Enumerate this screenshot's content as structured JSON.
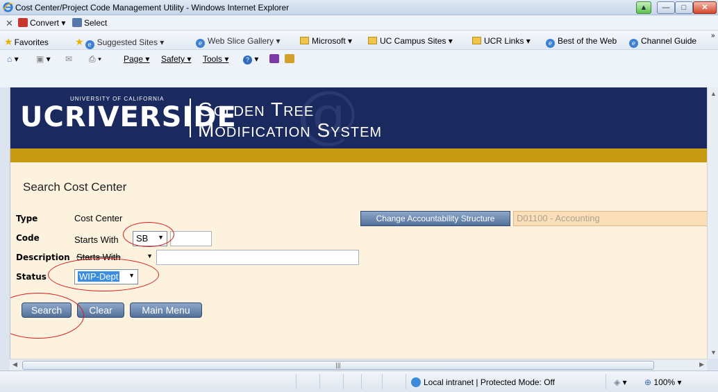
{
  "window": {
    "title": "Cost Center/Project Code Management Utility - Windows Internet Explorer"
  },
  "command_bar_1": {
    "convert_label": "Convert",
    "select_label": "Select"
  },
  "favorites_bar": {
    "favorites_label": "Favorites",
    "items": [
      "Suggested Sites",
      "Web Slice Gallery",
      "Microsoft",
      "UC Campus Sites",
      "UCR Links",
      "Best of the Web",
      "Channel Guide"
    ]
  },
  "command_bar_2": {
    "page_label": "Page",
    "safety_label": "Safety",
    "tools_label": "Tools"
  },
  "banner": {
    "uc_logo": "UCRIVERSIDE",
    "uc_subtitle": "UNIVERSITY OF CALIFORNIA",
    "system_line1": "Golden Tree",
    "system_line2": "Modification System"
  },
  "form": {
    "page_title": "Search Cost Center",
    "type_label": "Type",
    "type_value": "Cost Center",
    "code_label": "Code",
    "code_match": "Starts With",
    "code_select": "SB",
    "code_input": "",
    "description_label": "Description",
    "description_match": "Starts With",
    "description_input": "",
    "status_label": "Status",
    "status_select": "WIP-Dept",
    "change_structure_button": "Change Accountability Structure",
    "accountability_value": "D01100 - Accounting",
    "search_button": "Search",
    "clear_button": "Clear",
    "main_menu_button": "Main Menu"
  },
  "status_bar": {
    "zone": "Local intranet | Protected Mode: Off",
    "zoom": "100%"
  }
}
